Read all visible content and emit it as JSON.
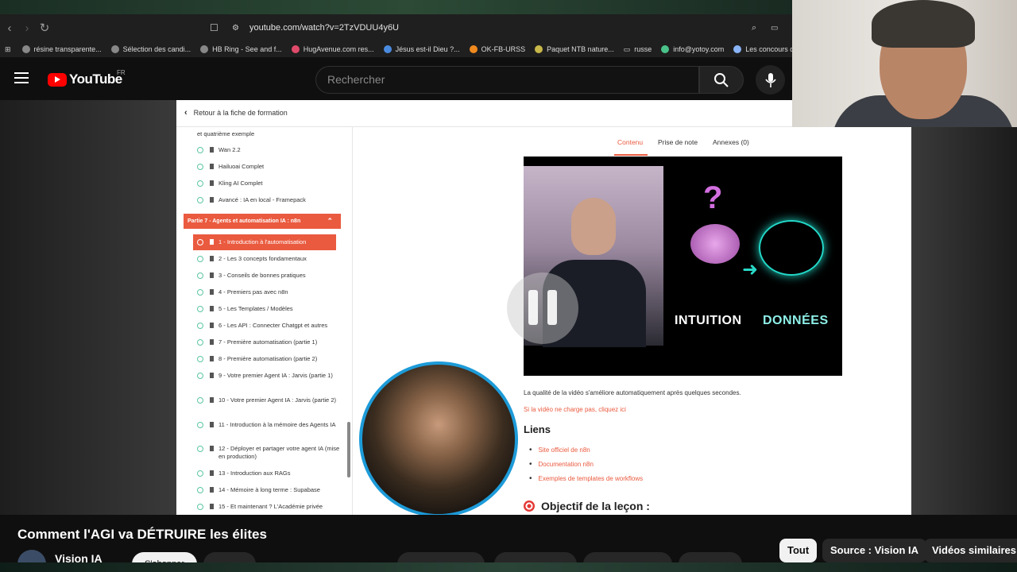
{
  "browser": {
    "url": "youtube.com/watch?v=2TzVDUU4y6U",
    "bookmarks": [
      "résine transparente...",
      "Sélection des candi...",
      "HB Ring - See and f...",
      "HugAvenue.com res...",
      "Jésus est-il Dieu ?...",
      "OK-FB-URSS",
      "Paquet NTB nature...",
      "russe",
      "info@yotoy.com",
      "Les concours d'"
    ]
  },
  "youtube": {
    "logo": "YouTube",
    "region": "FR",
    "search_placeholder": "Rechercher"
  },
  "course": {
    "back_label": "Retour à la fiche de formation",
    "prev_lessons": [
      "et quatrième exemple",
      "Wan 2.2",
      "Hailuoai Complet",
      "Kling AI Complet",
      "Avancé : IA en local - Framepack"
    ],
    "part7_title": "Partie 7 - Agents et automatisation IA : n8n",
    "lessons": [
      "1 - Introduction à l'automatisation",
      "2 - Les 3 concepts fondamentaux",
      "3 - Conseils de bonnes pratiques",
      "4 - Premiers pas avec n8n",
      "5 - Les Templates / Modèles",
      "6 - Les API : Connecter Chatgpt et autres",
      "7 - Première automatisation (partie 1)",
      "8 - Première automatisation (partie 2)",
      "9 - Votre premier Agent IA : Jarvis (partie 1)",
      "10 - Votre premier Agent IA : Jarvis (partie 2)",
      "11 - Introduction à la mémoire des Agents IA",
      "12 - Déployer et partager votre agent IA (mise en production)",
      "13 - Introduction aux RAGs",
      "14 - Mémoire à long terme : Supabase",
      "15 - Et maintenant ? L'Académie privée"
    ],
    "tabs": [
      "Contenu",
      "Prise de note",
      "Annexes (0)"
    ],
    "video_labels": {
      "left": "INTUITION",
      "right": "DONNÉES",
      "question": "?"
    },
    "quality_note": "La qualité de la vidéo s'améliore automatiquement après quelques secondes.",
    "reload_link": "Si la vidéo ne charge pas, cliquez ici",
    "links_heading": "Liens",
    "links": [
      "Site officiel de n8n",
      "Documentation n8n",
      "Exemples de templates de workflows"
    ],
    "objective_heading": "Objectif de la leçon :"
  },
  "video_info": {
    "title": "Comment l'AGI va DÉTRUIRE les élites",
    "channel": "Vision IA",
    "subscribe_label": "S'abonner",
    "chips": [
      "Tout",
      "Source : Vision IA",
      "Vidéos similaires"
    ]
  }
}
